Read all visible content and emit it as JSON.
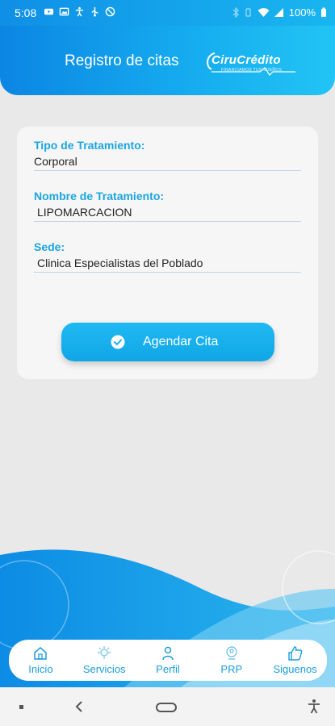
{
  "status_bar": {
    "time": "5:08",
    "battery": "100%",
    "left_icons": [
      "youtube-icon",
      "image-icon",
      "accessibility-icon",
      "usb-icon",
      "nosim-icon"
    ],
    "right_icons": [
      "bluetooth-icon",
      "vibrate-icon",
      "wifi-icon",
      "signal-icon",
      "battery-icon"
    ]
  },
  "header": {
    "title": "Registro de citas",
    "brand": {
      "name": "CiruCrédito",
      "tagline": "FINANCIAMOS TUS SUEÑOS"
    }
  },
  "form": {
    "fields": [
      {
        "label": "Tipo de Tratamiento:",
        "value": "Corporal"
      },
      {
        "label": "Nombre de Tratamiento:",
        "value": "LIPOMARCACION"
      },
      {
        "label": "Sede:",
        "value": "Clinica Especialistas del Poblado"
      }
    ],
    "submit": {
      "label": "Agendar Cita",
      "icon": "check-circle-icon"
    }
  },
  "bottom_nav": {
    "items": [
      {
        "label": "Inicio",
        "icon": "home-icon"
      },
      {
        "label": "Servicios",
        "icon": "services-icon"
      },
      {
        "label": "Perfil",
        "icon": "user-icon"
      },
      {
        "label": "PRP",
        "icon": "prp-icon"
      },
      {
        "label": "Siguenos",
        "icon": "thumbs-up-icon"
      }
    ]
  },
  "colors": {
    "primary": "#16aef0",
    "label": "#1ba6e0",
    "background": "#e9e9e9"
  }
}
